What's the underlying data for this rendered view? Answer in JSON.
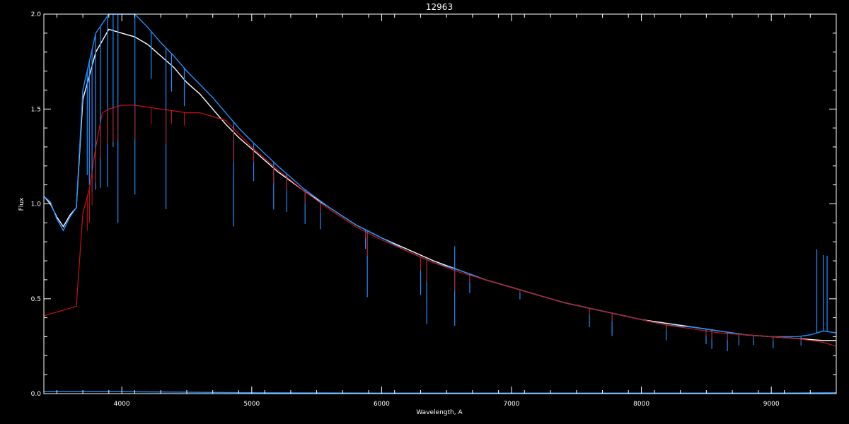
{
  "chart_data": {
    "type": "line",
    "title": "12963",
    "xlabel": "Wavelength, A",
    "ylabel": "Flux",
    "xlim": [
      3400,
      9500
    ],
    "ylim": [
      0.0,
      2.0
    ],
    "xticks": [
      4000,
      5000,
      6000,
      7000,
      8000,
      9000
    ],
    "yticks": [
      0.0,
      0.5,
      1.0,
      1.5,
      2.0
    ],
    "ytick_labels": [
      "0.0",
      "0.5",
      "1.0",
      "1.5",
      "2.0"
    ],
    "grid": false,
    "background": "#000000",
    "series": [
      {
        "color": "#ffffff",
        "points": [
          [
            3400,
            1.04
          ],
          [
            3450,
            1.0
          ],
          [
            3500,
            0.93
          ],
          [
            3550,
            0.88
          ],
          [
            3600,
            0.94
          ],
          [
            3650,
            0.98
          ],
          [
            3700,
            1.55
          ],
          [
            3800,
            1.8
          ],
          [
            3900,
            1.92
          ],
          [
            4000,
            1.9
          ],
          [
            4100,
            1.88
          ],
          [
            4200,
            1.84
          ],
          [
            4300,
            1.78
          ],
          [
            4400,
            1.72
          ],
          [
            4500,
            1.64
          ],
          [
            4600,
            1.58
          ],
          [
            4700,
            1.5
          ],
          [
            4800,
            1.42
          ],
          [
            4900,
            1.35
          ],
          [
            5000,
            1.29
          ],
          [
            5200,
            1.17
          ],
          [
            5400,
            1.07
          ],
          [
            5600,
            0.98
          ],
          [
            5800,
            0.89
          ],
          [
            6000,
            0.82
          ],
          [
            6200,
            0.76
          ],
          [
            6400,
            0.7
          ],
          [
            6600,
            0.65
          ],
          [
            6800,
            0.6
          ],
          [
            7000,
            0.56
          ],
          [
            7200,
            0.52
          ],
          [
            7400,
            0.48
          ],
          [
            7600,
            0.45
          ],
          [
            7800,
            0.42
          ],
          [
            8000,
            0.39
          ],
          [
            8200,
            0.37
          ],
          [
            8400,
            0.35
          ],
          [
            8600,
            0.33
          ],
          [
            8800,
            0.31
          ],
          [
            9000,
            0.3
          ],
          [
            9200,
            0.29
          ],
          [
            9400,
            0.28
          ],
          [
            9500,
            0.28
          ]
        ]
      },
      {
        "color": "#1e90ff",
        "points": [
          [
            3400,
            1.04
          ],
          [
            3450,
            1.01
          ],
          [
            3500,
            0.92
          ],
          [
            3550,
            0.86
          ],
          [
            3600,
            0.93
          ],
          [
            3650,
            0.98
          ],
          [
            3700,
            1.6
          ],
          [
            3800,
            1.9
          ],
          [
            3900,
            2.0
          ],
          [
            4000,
            2.0
          ],
          [
            4100,
            2.0
          ],
          [
            4200,
            1.93
          ],
          [
            4300,
            1.85
          ],
          [
            4400,
            1.78
          ],
          [
            4500,
            1.7
          ],
          [
            4600,
            1.63
          ],
          [
            4700,
            1.56
          ],
          [
            4800,
            1.48
          ],
          [
            4900,
            1.4
          ],
          [
            5000,
            1.33
          ],
          [
            5200,
            1.2
          ],
          [
            5400,
            1.08
          ],
          [
            5600,
            0.98
          ],
          [
            5800,
            0.89
          ],
          [
            6000,
            0.82
          ],
          [
            6200,
            0.75
          ],
          [
            6400,
            0.69
          ],
          [
            6600,
            0.65
          ],
          [
            6800,
            0.6
          ],
          [
            7000,
            0.56
          ],
          [
            7200,
            0.52
          ],
          [
            7400,
            0.48
          ],
          [
            7600,
            0.45
          ],
          [
            7800,
            0.42
          ],
          [
            8000,
            0.39
          ],
          [
            8200,
            0.36
          ],
          [
            8400,
            0.35
          ],
          [
            8600,
            0.33
          ],
          [
            8800,
            0.31
          ],
          [
            9000,
            0.3
          ],
          [
            9200,
            0.3
          ],
          [
            9300,
            0.31
          ],
          [
            9400,
            0.33
          ],
          [
            9500,
            0.32
          ]
        ]
      },
      {
        "color": "#cc1111",
        "points": [
          [
            3400,
            0.41
          ],
          [
            3500,
            0.43
          ],
          [
            3600,
            0.45
          ],
          [
            3650,
            0.46
          ],
          [
            3700,
            0.95
          ],
          [
            3750,
            1.08
          ],
          [
            3800,
            1.3
          ],
          [
            3850,
            1.48
          ],
          [
            3900,
            1.5
          ],
          [
            4000,
            1.52
          ],
          [
            4100,
            1.52
          ],
          [
            4200,
            1.51
          ],
          [
            4300,
            1.5
          ],
          [
            4400,
            1.49
          ],
          [
            4500,
            1.48
          ],
          [
            4600,
            1.48
          ],
          [
            4700,
            1.46
          ],
          [
            4800,
            1.44
          ],
          [
            4900,
            1.37
          ],
          [
            5000,
            1.3
          ],
          [
            5200,
            1.18
          ],
          [
            5400,
            1.07
          ],
          [
            5600,
            0.97
          ],
          [
            5800,
            0.88
          ],
          [
            6000,
            0.81
          ],
          [
            6200,
            0.75
          ],
          [
            6400,
            0.69
          ],
          [
            6600,
            0.64
          ],
          [
            6800,
            0.6
          ],
          [
            7000,
            0.56
          ],
          [
            7200,
            0.52
          ],
          [
            7400,
            0.48
          ],
          [
            7600,
            0.45
          ],
          [
            7800,
            0.42
          ],
          [
            8000,
            0.39
          ],
          [
            8200,
            0.36
          ],
          [
            8400,
            0.34
          ],
          [
            8600,
            0.32
          ],
          [
            8800,
            0.31
          ],
          [
            9000,
            0.3
          ],
          [
            9200,
            0.29
          ],
          [
            9300,
            0.28
          ],
          [
            9400,
            0.27
          ],
          [
            9500,
            0.25
          ]
        ]
      },
      {
        "color": "#1e90ff",
        "points": [
          [
            3400,
            0.01
          ],
          [
            4000,
            0.01
          ],
          [
            5000,
            0.005
          ],
          [
            6000,
            0.003
          ],
          [
            7000,
            0.003
          ],
          [
            8000,
            0.003
          ],
          [
            9000,
            0.003
          ],
          [
            9500,
            0.005
          ]
        ]
      }
    ],
    "absorption_lines": [
      {
        "x": 3734,
        "depth": 0.55
      },
      {
        "x": 3750,
        "depth": 0.65
      },
      {
        "x": 3771,
        "depth": 0.75
      },
      {
        "x": 3798,
        "depth": 0.82
      },
      {
        "x": 3835,
        "depth": 0.85
      },
      {
        "x": 3889,
        "depth": 0.9
      },
      {
        "x": 3933,
        "depth": 0.7
      },
      {
        "x": 3970,
        "depth": 1.1
      },
      {
        "x": 4101,
        "depth": 0.95
      },
      {
        "x": 4226,
        "depth": 0.25
      },
      {
        "x": 4340,
        "depth": 0.85
      },
      {
        "x": 4383,
        "depth": 0.2
      },
      {
        "x": 4481,
        "depth": 0.2
      },
      {
        "x": 4861,
        "depth": 0.55
      },
      {
        "x": 5015,
        "depth": 0.2
      },
      {
        "x": 5169,
        "depth": 0.25
      },
      {
        "x": 5270,
        "depth": 0.2
      },
      {
        "x": 5411,
        "depth": 0.18
      },
      {
        "x": 5528,
        "depth": 0.15
      },
      {
        "x": 5876,
        "depth": 0.1
      },
      {
        "x": 5890,
        "depth": 0.35
      },
      {
        "x": 6300,
        "depth": 0.2
      },
      {
        "x": 6347,
        "depth": 0.34
      },
      {
        "x": 6563,
        "depth": 0.3
      },
      {
        "x": 6678,
        "depth": 0.1
      },
      {
        "x": 7065,
        "depth": 0.05
      },
      {
        "x": 7600,
        "depth": 0.1
      },
      {
        "x": 7774,
        "depth": 0.12
      },
      {
        "x": 8191,
        "depth": 0.08
      },
      {
        "x": 8498,
        "depth": 0.08
      },
      {
        "x": 8542,
        "depth": 0.1
      },
      {
        "x": 8662,
        "depth": 0.1
      },
      {
        "x": 8750,
        "depth": 0.06
      },
      {
        "x": 8862,
        "depth": 0.05
      },
      {
        "x": 9014,
        "depth": 0.06
      },
      {
        "x": 9229,
        "depth": 0.05
      }
    ],
    "emission_spikes": [
      {
        "x": 6563,
        "height": 0.12
      },
      {
        "x": 9350,
        "height": 0.44
      },
      {
        "x": 9400,
        "height": 0.4
      },
      {
        "x": 9430,
        "height": 0.4
      }
    ]
  }
}
